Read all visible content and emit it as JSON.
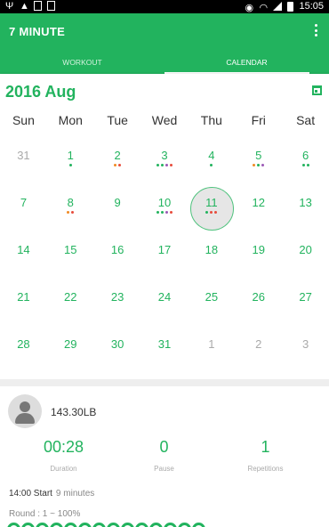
{
  "status_bar": {
    "time": "15:05"
  },
  "app": {
    "title": "7 MINUTE"
  },
  "tabs": [
    {
      "label": "WORKOUT",
      "active": false
    },
    {
      "label": "CALENDAR",
      "active": true
    }
  ],
  "calendar": {
    "month_label": "2016 Aug",
    "weekdays": [
      "Sun",
      "Mon",
      "Tue",
      "Wed",
      "Thu",
      "Fri",
      "Sat"
    ],
    "weeks": [
      [
        {
          "d": "31",
          "other": true,
          "dots": []
        },
        {
          "d": "1",
          "dots": [
            "#22b35e"
          ]
        },
        {
          "d": "2",
          "dots": [
            "#f08a24",
            "#e74c3c"
          ]
        },
        {
          "d": "3",
          "dots": [
            "#22b35e",
            "#22b35e",
            "#9b59b6",
            "#e74c3c"
          ]
        },
        {
          "d": "4",
          "dots": [
            "#22b35e"
          ]
        },
        {
          "d": "5",
          "dots": [
            "#f08a24",
            "#22b35e",
            "#9b59b6"
          ]
        },
        {
          "d": "6",
          "dots": [
            "#22b35e",
            "#22b35e"
          ]
        }
      ],
      [
        {
          "d": "7",
          "dots": []
        },
        {
          "d": "8",
          "dots": [
            "#f08a24",
            "#e74c3c"
          ]
        },
        {
          "d": "9",
          "dots": []
        },
        {
          "d": "10",
          "dots": [
            "#22b35e",
            "#22b35e",
            "#9b59b6",
            "#e74c3c"
          ]
        },
        {
          "d": "11",
          "today": true,
          "dots": [
            "#22b35e",
            "#e74c3c",
            "#e74c3c"
          ]
        },
        {
          "d": "12",
          "dots": []
        },
        {
          "d": "13",
          "dots": []
        }
      ],
      [
        {
          "d": "14",
          "dots": []
        },
        {
          "d": "15",
          "dots": []
        },
        {
          "d": "16",
          "dots": []
        },
        {
          "d": "17",
          "dots": []
        },
        {
          "d": "18",
          "dots": []
        },
        {
          "d": "19",
          "dots": []
        },
        {
          "d": "20",
          "dots": []
        }
      ],
      [
        {
          "d": "21",
          "dots": []
        },
        {
          "d": "22",
          "dots": []
        },
        {
          "d": "23",
          "dots": []
        },
        {
          "d": "24",
          "dots": []
        },
        {
          "d": "25",
          "dots": []
        },
        {
          "d": "26",
          "dots": []
        },
        {
          "d": "27",
          "dots": []
        }
      ],
      [
        {
          "d": "28",
          "dots": []
        },
        {
          "d": "29",
          "dots": []
        },
        {
          "d": "30",
          "dots": []
        },
        {
          "d": "31",
          "dots": []
        },
        {
          "d": "1",
          "other": true,
          "dots": []
        },
        {
          "d": "2",
          "other": true,
          "dots": []
        },
        {
          "d": "3",
          "other": true,
          "dots": []
        }
      ]
    ]
  },
  "stats": {
    "weight": "143.30LB",
    "duration": {
      "value": "00:28",
      "label": "Duration"
    },
    "pause": {
      "value": "0",
      "label": "Pause"
    },
    "repetitions": {
      "value": "1",
      "label": "Repetitions"
    },
    "start_time": "14:00 Start",
    "total_time": "9 minutes",
    "round": "Round : 1 ~ 100%"
  },
  "colors": {
    "accent": "#22b35e"
  }
}
